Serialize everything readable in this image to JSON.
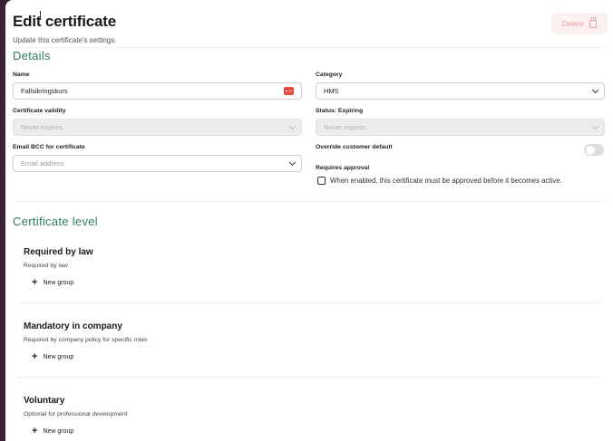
{
  "header": {
    "title": "Edit certificate",
    "subtitle": "Update this certificate's settings.",
    "delete_label": "Delete"
  },
  "details": {
    "title": "Details",
    "name_label": "Name",
    "name_value": "Fallsikringskurs",
    "category_label": "Category",
    "category_value": "HMS",
    "validity_label": "Certificate validity",
    "validity_value": "Never expires",
    "status_label": "Status: Expiring",
    "status_value": "Never expires",
    "email_label": "Email BCC for certificate",
    "email_placeholder": "Email address",
    "override_label": "Override customer default",
    "approval_label": "Requires approval",
    "approval_text": "When enabled, this certificate must be approved before it becomes active."
  },
  "levels": {
    "title": "Certificate level",
    "items": [
      {
        "title": "Required by law",
        "description": "Required by law",
        "action": "New group"
      },
      {
        "title": "Mandatory in company",
        "description": "Required by company policy for specific roles",
        "action": "New group"
      },
      {
        "title": "Voluntary",
        "description": "Optional for professional development",
        "action": "New group"
      }
    ]
  }
}
